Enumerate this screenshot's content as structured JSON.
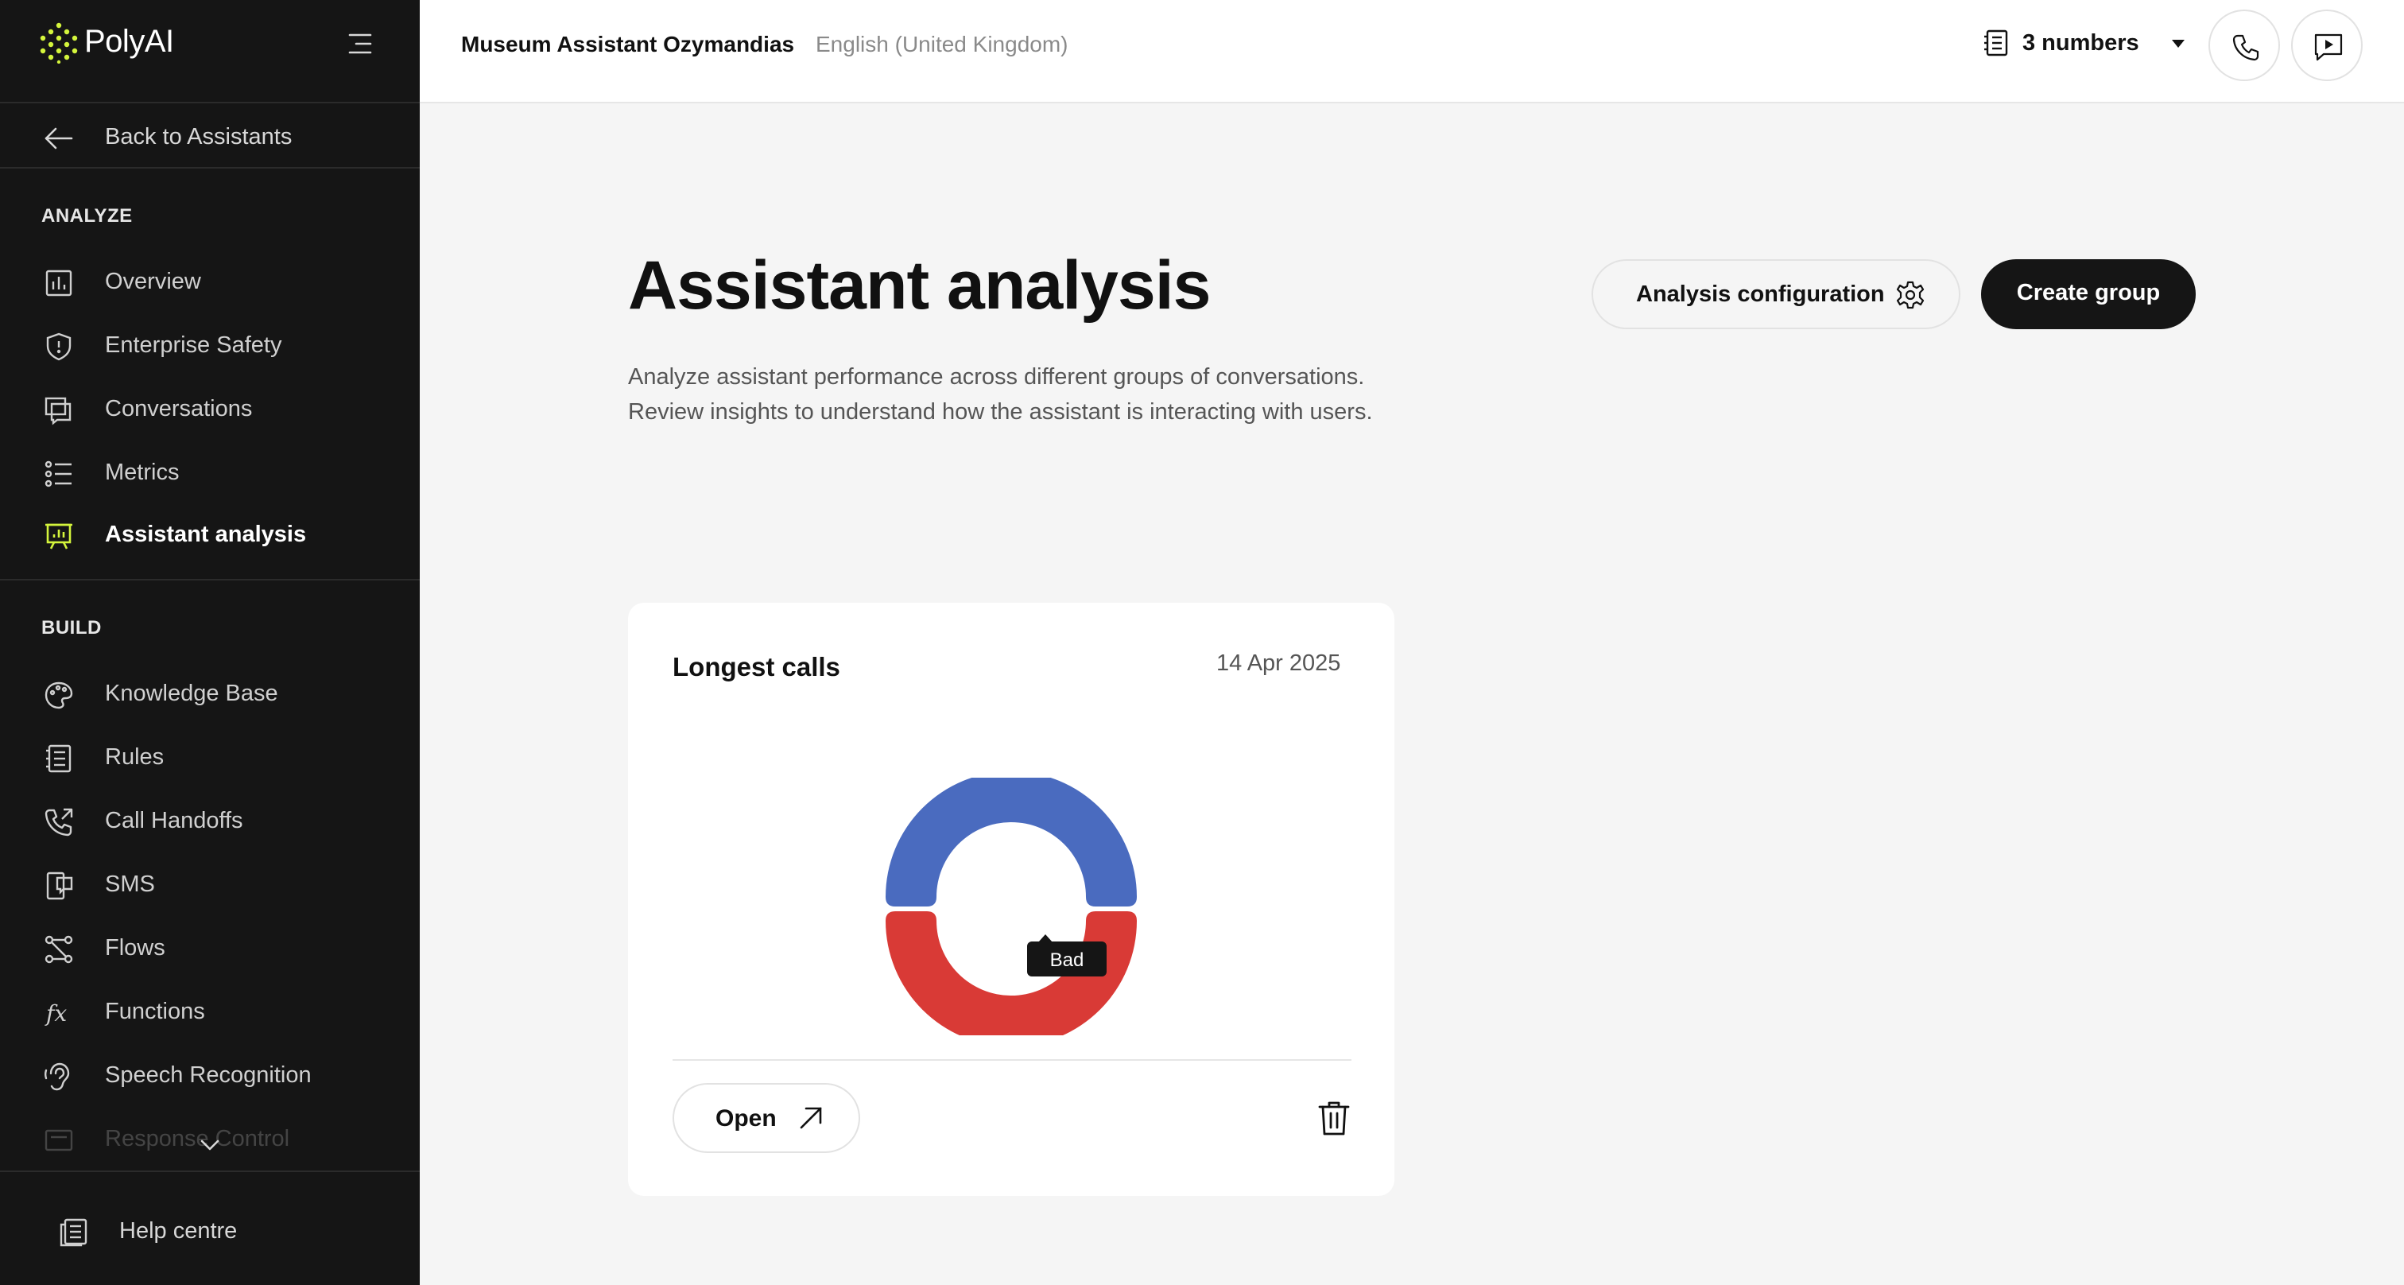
{
  "brand": {
    "name": "PolyAI",
    "accent": "#d4f53c"
  },
  "sidebar": {
    "back_label": "Back to Assistants",
    "analyze_label": "ANALYZE",
    "analyze_items": [
      {
        "label": "Overview",
        "icon": "bar-chart-icon"
      },
      {
        "label": "Enterprise Safety",
        "icon": "shield-icon"
      },
      {
        "label": "Conversations",
        "icon": "chat-icon"
      },
      {
        "label": "Metrics",
        "icon": "list-icon"
      },
      {
        "label": "Assistant analysis",
        "icon": "presentation-icon",
        "active": true
      }
    ],
    "build_label": "BUILD",
    "build_items": [
      {
        "label": "Knowledge Base",
        "icon": "palette-icon"
      },
      {
        "label": "Rules",
        "icon": "document-icon"
      },
      {
        "label": "Call Handoffs",
        "icon": "phone-forward-icon"
      },
      {
        "label": "SMS",
        "icon": "mobile-message-icon"
      },
      {
        "label": "Flows",
        "icon": "flow-icon"
      },
      {
        "label": "Functions",
        "icon": "function-icon"
      },
      {
        "label": "Speech Recognition",
        "icon": "ear-icon"
      },
      {
        "label": "Response Control",
        "icon": "control-icon"
      }
    ],
    "help_label": "Help centre"
  },
  "topbar": {
    "assistant_name": "Museum Assistant Ozymandias",
    "language": "English (United Kingdom)",
    "numbers_label": "3 numbers"
  },
  "main": {
    "title": "Assistant analysis",
    "description_line1": "Analyze assistant performance across different groups of conversations.",
    "description_line2": "Review insights to understand how the assistant is interacting with users.",
    "config_button": "Analysis configuration",
    "create_button": "Create group"
  },
  "card": {
    "title": "Longest calls",
    "date": "14 Apr 2025",
    "tooltip": "Bad",
    "open_button": "Open",
    "donut_colors": {
      "good": "#4a6bbf",
      "bad": "#d93a36"
    }
  }
}
